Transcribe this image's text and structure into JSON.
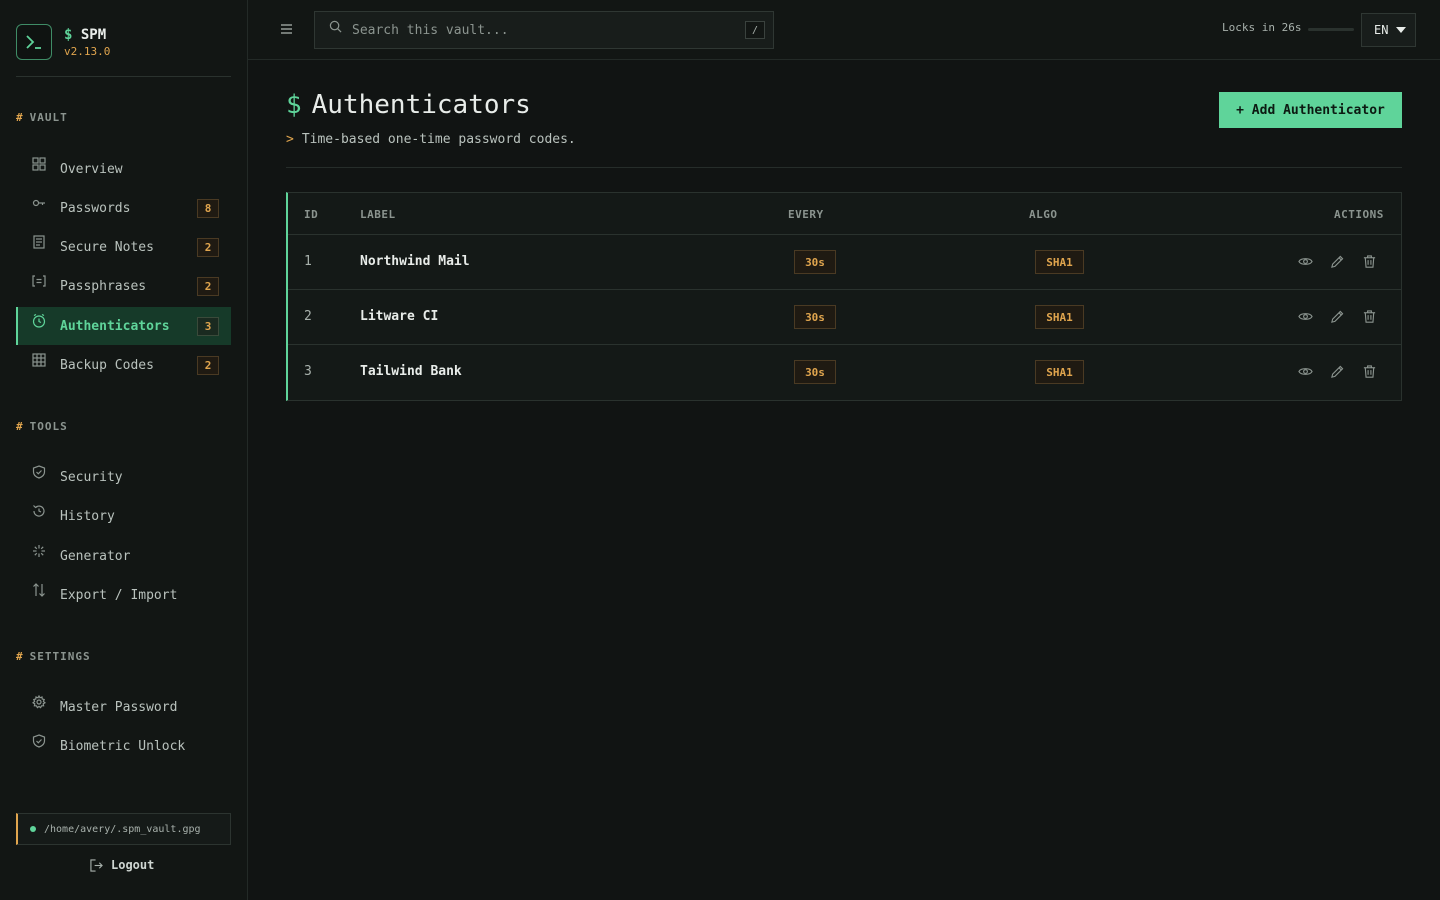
{
  "brand": {
    "dollar": "$",
    "name": "SPM",
    "version": "v2.13.0"
  },
  "sections": {
    "vault": {
      "hash": "#",
      "title": "VAULT"
    },
    "tools": {
      "hash": "#",
      "title": "TOOLS"
    },
    "settings": {
      "hash": "#",
      "title": "SETTINGS"
    }
  },
  "nav": {
    "overview": {
      "label": "Overview"
    },
    "passwords": {
      "label": "Passwords",
      "count": "8"
    },
    "secure_notes": {
      "label": "Secure Notes",
      "count": "2"
    },
    "passphrases": {
      "label": "Passphrases",
      "count": "2"
    },
    "authenticators": {
      "label": "Authenticators",
      "count": "3"
    },
    "backup_codes": {
      "label": "Backup Codes",
      "count": "2"
    },
    "security": {
      "label": "Security"
    },
    "history": {
      "label": "History"
    },
    "generator": {
      "label": "Generator"
    },
    "export_import": {
      "label": "Export / Import"
    },
    "master_password": {
      "label": "Master Password"
    },
    "biometric_unlock": {
      "label": "Biometric Unlock"
    }
  },
  "vault_path": "/home/avery/.spm_vault.gpg",
  "logout_label": "Logout",
  "topbar": {
    "search_placeholder": "Search this vault...",
    "search_shortcut": "/",
    "locks_text": "Locks in 26s",
    "language": "EN"
  },
  "page": {
    "dollar": "$",
    "title": "Authenticators",
    "subtitle_prefix": ">",
    "subtitle": "Time-based one-time password codes.",
    "add_button": "+ Add Authenticator"
  },
  "table": {
    "headers": {
      "id": "ID",
      "label": "LABEL",
      "every": "EVERY",
      "algo": "ALGO",
      "actions": "ACTIONS"
    },
    "rows": [
      {
        "id": "1",
        "label": "Northwind Mail",
        "every": "30s",
        "algo": "SHA1"
      },
      {
        "id": "2",
        "label": "Litware CI",
        "every": "30s",
        "algo": "SHA1"
      },
      {
        "id": "3",
        "label": "Tailwind Bank",
        "every": "30s",
        "algo": "SHA1"
      }
    ]
  },
  "colors": {
    "accent": "#5fd49a",
    "warning": "#e0a54e",
    "background": "#111413"
  },
  "icons": [
    "terminal-logo-icon",
    "grid-icon",
    "key-icon",
    "note-icon",
    "brackets-icon",
    "clock-icon",
    "table-icon",
    "shield-icon",
    "history-icon",
    "sparkle-icon",
    "arrows-updown-icon",
    "gear-icon",
    "logout-icon",
    "menu-icon",
    "search-icon",
    "eye-icon",
    "pencil-icon",
    "trash-icon"
  ]
}
